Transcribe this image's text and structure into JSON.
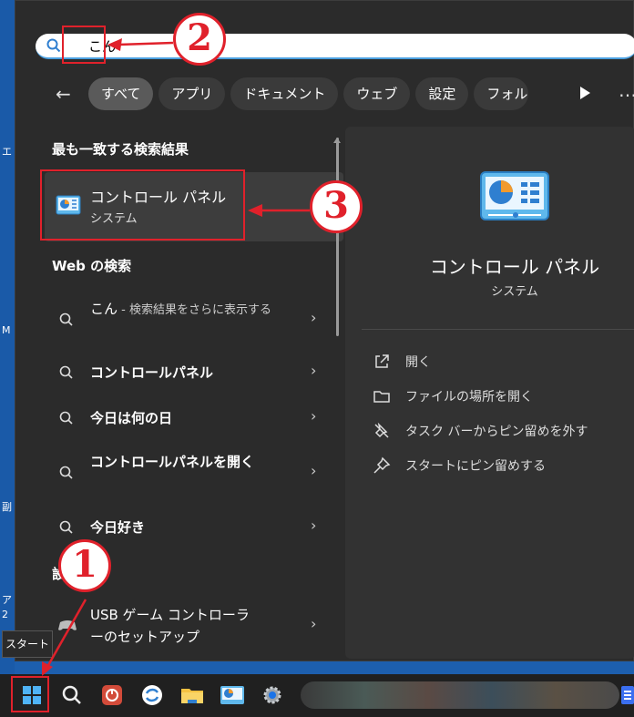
{
  "search": {
    "value": "こん"
  },
  "filters": {
    "chips": [
      "すべて",
      "アプリ",
      "ドキュメント",
      "ウェブ",
      "設定",
      "フォルダー"
    ]
  },
  "best_match": {
    "heading": "最も一致する検索結果",
    "name": "コントロール パネル",
    "subtitle": "システム"
  },
  "web": {
    "heading": "Web の検索",
    "items": [
      {
        "text": "こん",
        "hint": " - 検索結果をさらに表示する"
      },
      {
        "text": "コントロールパネル"
      },
      {
        "text": "今日は何の日"
      },
      {
        "text": "コントロールパネルを開く"
      },
      {
        "text": "今日好き"
      }
    ]
  },
  "settings": {
    "heading": "設定",
    "items": [
      {
        "text": "USB ゲーム コントローラーのセットアップ"
      }
    ]
  },
  "detail": {
    "title": "コントロール パネル",
    "subtitle": "システム",
    "actions": [
      {
        "label": "開く",
        "icon": "open-external-icon"
      },
      {
        "label": "ファイルの場所を開く",
        "icon": "folder-icon"
      },
      {
        "label": "タスク バーからピン留めを外す",
        "icon": "unpin-icon"
      },
      {
        "label": "スタートにピン留めする",
        "icon": "pin-icon"
      }
    ]
  },
  "taskbar": {
    "tooltip": "スタート"
  },
  "annotations": {
    "step1": "1",
    "step2": "2",
    "step3": "3"
  },
  "desktop_edge": [
    "エ",
    "M",
    "副",
    "ア",
    "2"
  ],
  "colors": {
    "accent_red": "#e0212b",
    "search_underline": "#4a9fe0"
  }
}
